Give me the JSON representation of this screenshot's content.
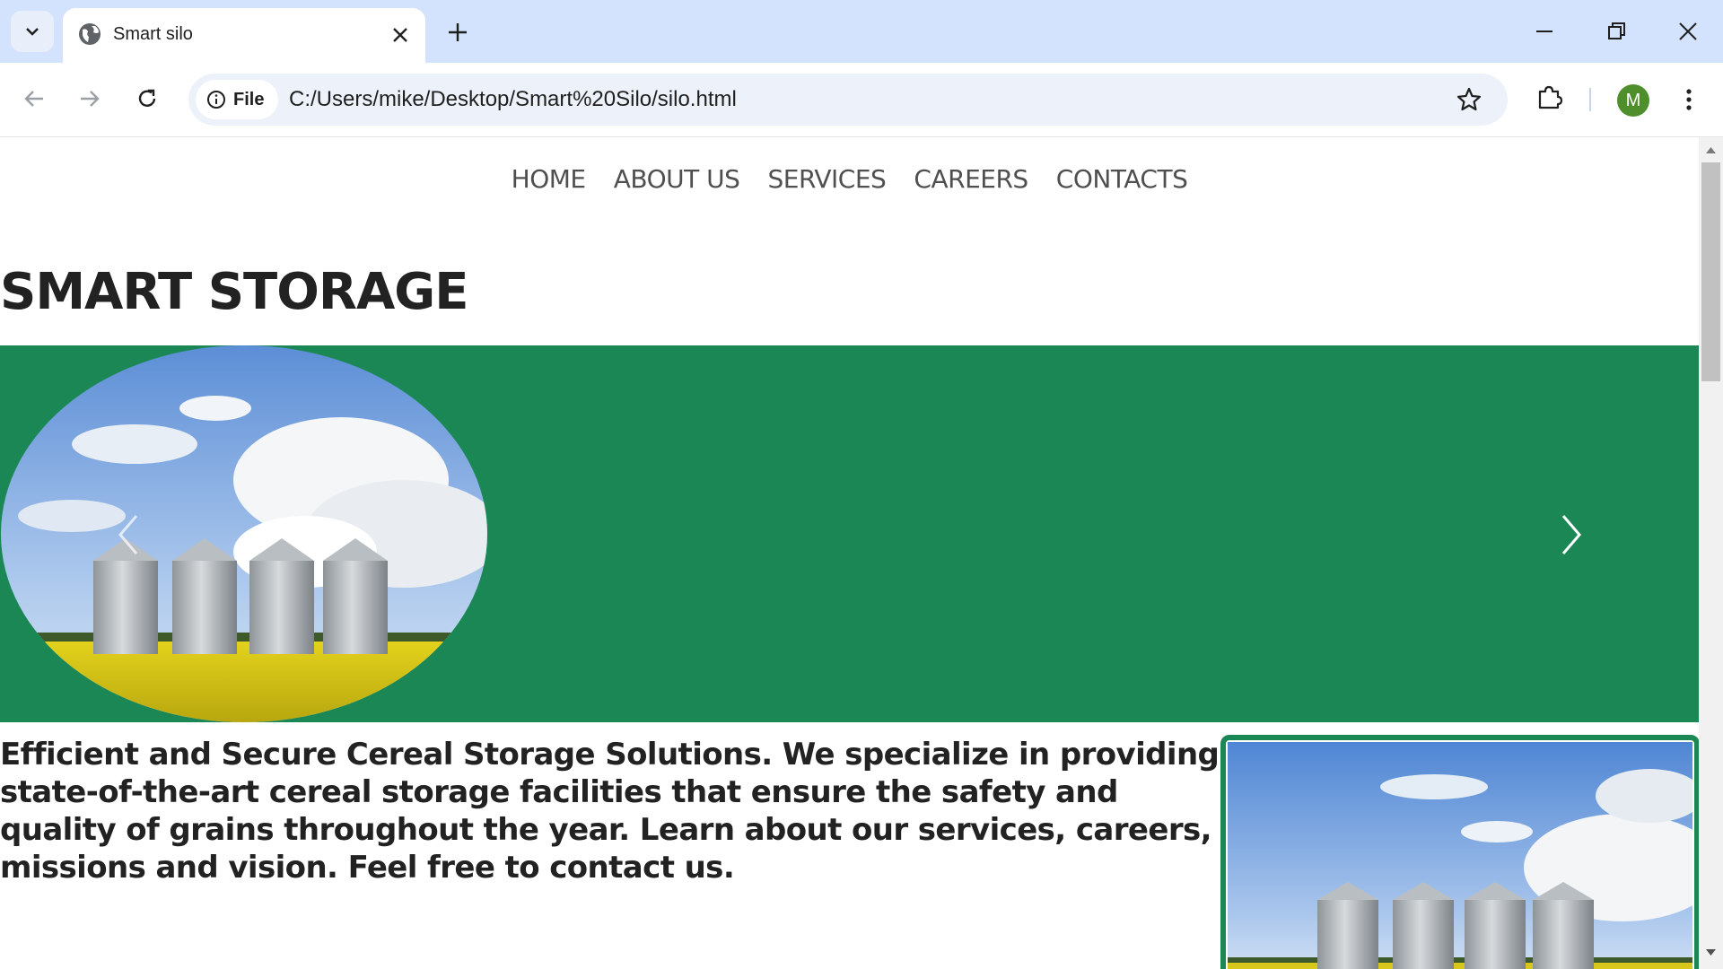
{
  "browser": {
    "tab_title": "Smart silo",
    "url_chip": "File",
    "url": "C:/Users/mike/Desktop/Smart%20Silo/silo.html",
    "profile_initial": "M"
  },
  "site": {
    "nav": [
      "HOME",
      "ABOUT US",
      "SERVICES",
      "CAREERS",
      "CONTACTS"
    ],
    "title": "SMART STORAGE",
    "intro": "Efficient and Secure Cereal Storage Solutions. We specialize in providing state-of-the-art cereal storage facilities that ensure the safety and quality of grains throughout the year. Learn about our services, careers, missions and vision. Feel free to contact us."
  },
  "colors": {
    "brand_green": "#1b8755",
    "tabbar": "#d3e3fd",
    "omnibox": "#edf2fa"
  },
  "icons": [
    "tab-search-icon",
    "globe-icon",
    "close-icon",
    "plus-icon",
    "minimize-icon",
    "restore-icon",
    "window-close-icon",
    "back-icon",
    "forward-icon",
    "reload-icon",
    "info-icon",
    "star-icon",
    "extensions-icon",
    "more-icon",
    "chevron-left-icon",
    "chevron-right-icon"
  ]
}
